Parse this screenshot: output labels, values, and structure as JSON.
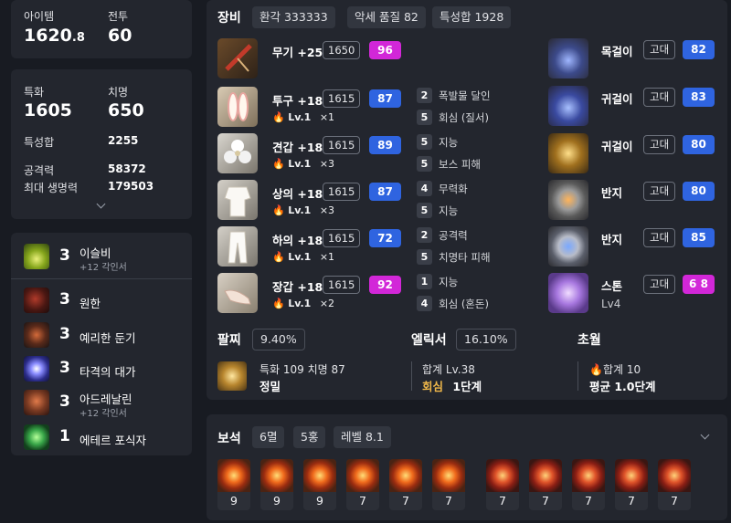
{
  "summary": {
    "item_level_label": "아이템",
    "item_level_int": "1620",
    "item_level_dec": ".8",
    "combat_label": "전투",
    "combat_value": "60"
  },
  "stats": {
    "spec_label": "특화",
    "spec_value": "1605",
    "crit_label": "치명",
    "crit_value": "650",
    "total_label": "특성합",
    "total_value": "2255",
    "atk_label": "공격력",
    "atk_value": "58372",
    "hp_label": "최대 생명력",
    "hp_value": "179503"
  },
  "engravings": [
    {
      "count": "3",
      "name": "이슬비",
      "sub": "+12 각인서",
      "icon": "drizzle-engraving-icon"
    },
    {
      "count": "3",
      "name": "원한",
      "sub": "",
      "icon": "grudge-engraving-icon"
    },
    {
      "count": "3",
      "name": "예리한 둔기",
      "sub": "",
      "icon": "keen-blunt-engraving-icon"
    },
    {
      "count": "3",
      "name": "타격의 대가",
      "sub": "",
      "icon": "hit-master-engraving-icon"
    },
    {
      "count": "3",
      "name": "아드레날린",
      "sub": "+12 각인서",
      "icon": "adrenaline-engraving-icon"
    },
    {
      "count": "1",
      "name": "에테르 포식자",
      "sub": "",
      "icon": "ether-predator-engraving-icon"
    }
  ],
  "equipment": {
    "title": "장비",
    "chips": [
      "환각 333333",
      "악세 품질 82",
      "특성합 1928"
    ],
    "gear": [
      {
        "name": "무기 +25",
        "level": "1650",
        "quality": "96",
        "quality_color": "pink",
        "elixir": "",
        "elixir_count": "",
        "icon": "parasol-weapon-icon"
      },
      {
        "name": "투구 +18",
        "level": "1615",
        "quality": "87",
        "quality_color": "blue",
        "elixir": "Lv.1",
        "elixir_count": "×1",
        "icon": "bunny-ears-helmet-icon"
      },
      {
        "name": "견갑 +18",
        "level": "1615",
        "quality": "89",
        "quality_color": "blue",
        "elixir": "Lv.1",
        "elixir_count": "×3",
        "icon": "flower-shoulder-icon"
      },
      {
        "name": "상의 +18",
        "level": "1615",
        "quality": "87",
        "quality_color": "blue",
        "elixir": "Lv.1",
        "elixir_count": "×3",
        "icon": "white-dress-top-icon"
      },
      {
        "name": "하의 +18",
        "level": "1615",
        "quality": "72",
        "quality_color": "blue",
        "elixir": "Lv.1",
        "elixir_count": "×1",
        "icon": "white-pants-icon"
      },
      {
        "name": "장갑 +18",
        "level": "1615",
        "quality": "92",
        "quality_color": "pink",
        "elixir": "Lv.1",
        "elixir_count": "×2",
        "icon": "glove-hand-icon"
      }
    ],
    "options": [
      {
        "n": "2",
        "t": "폭발물 달인"
      },
      {
        "n": "5",
        "t": "회심 (질서)"
      },
      {
        "n": "5",
        "t": "지능"
      },
      {
        "n": "5",
        "t": "보스 피해"
      },
      {
        "n": "4",
        "t": "무력화"
      },
      {
        "n": "5",
        "t": "지능"
      },
      {
        "n": "2",
        "t": "공격력"
      },
      {
        "n": "5",
        "t": "치명타 피해"
      },
      {
        "n": "1",
        "t": "지능"
      },
      {
        "n": "4",
        "t": "회심 (혼돈)"
      }
    ],
    "accessories": [
      {
        "name": "목걸이",
        "grade": "고대",
        "quality": "82",
        "quality_color": "blue",
        "extra": "",
        "icon": "necklace-icon"
      },
      {
        "name": "귀걸이",
        "grade": "고대",
        "quality": "83",
        "quality_color": "blue",
        "extra": "",
        "icon": "earring-icon"
      },
      {
        "name": "귀걸이",
        "grade": "고대",
        "quality": "80",
        "quality_color": "blue",
        "extra": "",
        "icon": "earring-icon"
      },
      {
        "name": "반지",
        "grade": "고대",
        "quality": "80",
        "quality_color": "blue",
        "extra": "",
        "icon": "ring-icon"
      },
      {
        "name": "반지",
        "grade": "고대",
        "quality": "85",
        "quality_color": "blue",
        "extra": "",
        "icon": "ring-icon"
      },
      {
        "name": "스톤",
        "grade": "고대",
        "quality": "6 8",
        "quality_color": "pink",
        "extra": "Lv4",
        "icon": "ability-stone-icon"
      }
    ]
  },
  "bracelet": {
    "title": "팔찌",
    "percent": "9.40%",
    "line1": "특화 109  치명 87",
    "line2": "정밀"
  },
  "elixir": {
    "title": "엘릭서",
    "percent": "16.10%",
    "line1": "합계 Lv.38",
    "line2_a": "회심",
    "line2_b": "1단계"
  },
  "transcend": {
    "title": "초월",
    "line1": "합계 10",
    "line2": "평균 1.0단계"
  },
  "gems": {
    "title": "보석",
    "chips": [
      "6멸",
      "5홍",
      "레벨 8.1"
    ],
    "levels": [
      "9",
      "9",
      "9",
      "7",
      "7",
      "7",
      "7",
      "7",
      "7",
      "7",
      "7"
    ]
  }
}
